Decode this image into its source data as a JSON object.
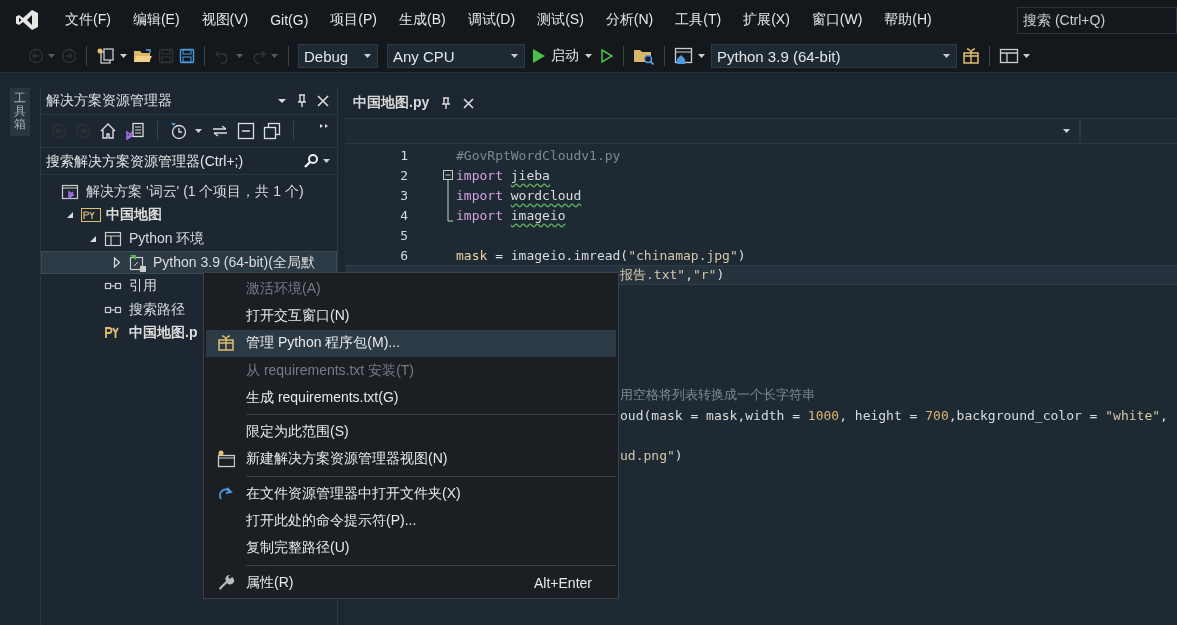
{
  "menu_bar": {
    "items": [
      "文件(F)",
      "编辑(E)",
      "视图(V)",
      "Git(G)",
      "项目(P)",
      "生成(B)",
      "调试(D)",
      "测试(S)",
      "分析(N)",
      "工具(T)",
      "扩展(X)",
      "窗口(W)",
      "帮助(H)"
    ],
    "search": {
      "placeholder": "搜索 (Ctrl+Q)"
    }
  },
  "toolbar": [
    {
      "kind": "back",
      "disabled": true
    },
    {
      "kind": "forward",
      "disabled": true
    },
    {
      "kind": "separator"
    },
    {
      "kind": "new-project",
      "disabled": false
    },
    {
      "kind": "open",
      "disabled": false
    },
    {
      "kind": "save",
      "disabled": true
    },
    {
      "kind": "save-all",
      "disabled": false
    },
    {
      "kind": "separator"
    },
    {
      "kind": "undo",
      "disabled": true
    },
    {
      "kind": "redo",
      "disabled": true
    },
    {
      "kind": "separator"
    },
    {
      "kind": "dropdown",
      "value": "Debug"
    },
    {
      "kind": "dropdown",
      "value": "Any CPU"
    },
    {
      "kind": "start",
      "label": "启动",
      "disabled": false
    },
    {
      "kind": "start-nodebug",
      "disabled": false
    },
    {
      "kind": "separator"
    },
    {
      "kind": "folder-search",
      "disabled": false
    },
    {
      "kind": "separator"
    },
    {
      "kind": "web",
      "disabled": false
    },
    {
      "kind": "dropdown",
      "value": "Python 3.9 (64-bit)"
    },
    {
      "kind": "package",
      "disabled": false
    },
    {
      "kind": "separator"
    },
    {
      "kind": "layout",
      "disabled": false
    }
  ],
  "side_tab": {
    "label": "工具箱"
  },
  "solution_explorer": {
    "title": "解决方案资源管理器",
    "toolbar": [
      {
        "kind": "back",
        "disabled": true
      },
      {
        "kind": "forward",
        "disabled": true
      },
      {
        "kind": "home",
        "disabled": false
      },
      {
        "kind": "switch-views",
        "disabled": false
      },
      {
        "kind": "separator"
      },
      {
        "kind": "pending-changes",
        "disabled": false
      },
      {
        "kind": "sync",
        "disabled": false
      },
      {
        "kind": "collapse",
        "disabled": false
      },
      {
        "kind": "show-all",
        "disabled": false
      },
      {
        "kind": "separator"
      },
      {
        "kind": "overflow",
        "disabled": false
      }
    ],
    "search": {
      "placeholder": "搜索解决方案资源管理器(Ctrl+;)"
    },
    "tree": [
      {
        "label": "解决方案 '词云' (1 个项目，共 1 个)",
        "kind": "solution",
        "selected": false,
        "children": [
          {
            "label": "中国地图",
            "kind": "project",
            "expanded": true,
            "selected": false,
            "children": [
              {
                "label": "Python 环境",
                "kind": "environments",
                "expanded": true,
                "selected": false,
                "children": [
                  {
                    "label": "Python 3.9 (64-bit)(全局默",
                    "kind": "environment",
                    "expanded": false,
                    "selected": true
                  }
                ]
              },
              {
                "label": "引用",
                "kind": "references",
                "selected": false
              },
              {
                "label": "搜索路径",
                "kind": "search-paths",
                "selected": false
              },
              {
                "label": "中国地图.p",
                "kind": "python-file",
                "selected": false
              }
            ]
          }
        ]
      }
    ]
  },
  "editor": {
    "tab": {
      "label": "中国地图.py",
      "selected": true
    },
    "lines": [
      {
        "number": "1",
        "kind": "plain",
        "current": false,
        "tokens": [
          {
            "text": "#GovRptWordCloudv1.py",
            "kind": "comment"
          }
        ]
      },
      {
        "number": "2",
        "kind": "fold-start",
        "current": false,
        "tokens": [
          {
            "text": "import",
            "kind": "keyword"
          },
          {
            "text": "jieba",
            "kind": "module"
          }
        ]
      },
      {
        "number": "3",
        "kind": "fold-inside",
        "current": false,
        "tokens": [
          {
            "text": "import",
            "kind": "keyword"
          },
          {
            "text": "wordcloud",
            "kind": "module"
          }
        ]
      },
      {
        "number": "4",
        "kind": "fold-end",
        "current": false,
        "tokens": [
          {
            "text": "import",
            "kind": "keyword"
          },
          {
            "text": "imageio",
            "kind": "module"
          }
        ]
      },
      {
        "number": "5",
        "kind": "plain",
        "current": false
      },
      {
        "number": "6",
        "kind": "plain",
        "current": false,
        "tokens": [
          {
            "text": "mask",
            "kind": "variable"
          },
          {
            "text": " = imageio.imread(",
            "kind": "plain"
          },
          {
            "text": "\"chinamap.jpg\"",
            "kind": "string"
          },
          {
            "text": ")",
            "kind": "plain"
          }
        ]
      },
      {
        "kind": "plain",
        "current": true,
        "tokens": [
          {
            "text": "报告.txt\"",
            "kind": "string"
          },
          {
            "text": ",",
            "kind": "plain"
          },
          {
            "text": "\"r\"",
            "kind": "string"
          },
          {
            "text": ")",
            "kind": "plain"
          }
        ]
      },
      {
        "kind": "plain",
        "current": false
      },
      {
        "kind": "plain",
        "current": false
      },
      {
        "kind": "plain",
        "current": false
      },
      {
        "kind": "plain",
        "current": false
      },
      {
        "kind": "plain",
        "current": false
      },
      {
        "kind": "plain",
        "current": false,
        "tokens": [
          {
            "text": "用空格将列表转换成一个长字符串",
            "kind": "comment"
          }
        ]
      },
      {
        "kind": "plain",
        "current": false,
        "tokens": [
          {
            "text": "oud(mask = mask,width = ",
            "kind": "plain"
          },
          {
            "text": "1000",
            "kind": "number"
          },
          {
            "text": ", height = ",
            "kind": "plain"
          },
          {
            "text": "700",
            "kind": "number"
          },
          {
            "text": ",background_color = ",
            "kind": "plain"
          },
          {
            "text": "\"white\"",
            "kind": "string"
          },
          {
            "text": ",",
            "kind": "plain"
          }
        ]
      },
      {
        "kind": "plain",
        "current": false
      },
      {
        "kind": "plain",
        "current": false,
        "tokens": [
          {
            "text": "ud.png\"",
            "kind": "string"
          },
          {
            "text": ")",
            "kind": "plain"
          }
        ]
      }
    ]
  },
  "context_menu": [
    {
      "kind": "item",
      "label": "激活环境(A)",
      "disabled": true,
      "selected": false
    },
    {
      "kind": "item",
      "label": "打开交互窗口(N)",
      "disabled": false,
      "selected": false
    },
    {
      "kind": "package-item",
      "label": "管理 Python 程序包(M)...",
      "disabled": false,
      "selected": true
    },
    {
      "kind": "item",
      "label": "从 requirements.txt 安装(T)",
      "disabled": true,
      "selected": false
    },
    {
      "kind": "item",
      "label": "生成 requirements.txt(G)",
      "disabled": false,
      "selected": false
    },
    {
      "kind": "separator"
    },
    {
      "kind": "item",
      "label": "限定为此范围(S)",
      "disabled": false,
      "selected": false
    },
    {
      "kind": "new-view-item",
      "label": "新建解决方案资源管理器视图(N)",
      "disabled": false,
      "selected": false
    },
    {
      "kind": "separator"
    },
    {
      "kind": "open-folder-item",
      "label": "在文件资源管理器中打开文件夹(X)",
      "disabled": false,
      "selected": false
    },
    {
      "kind": "item",
      "label": "打开此处的命令提示符(P)...",
      "disabled": false,
      "selected": false
    },
    {
      "kind": "item",
      "label": "复制完整路径(U)",
      "disabled": false,
      "selected": false
    },
    {
      "kind": "separator"
    },
    {
      "kind": "properties-item",
      "label": "属性(R)",
      "shortcut": "Alt+Enter",
      "disabled": false,
      "selected": false
    }
  ]
}
